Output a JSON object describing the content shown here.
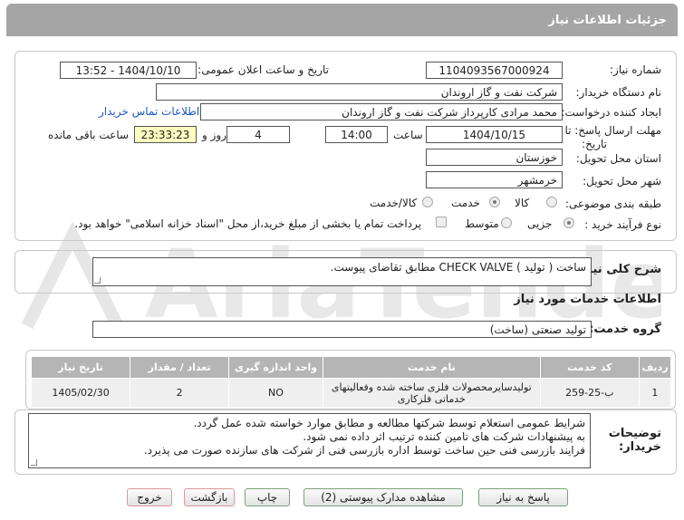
{
  "header": {
    "title": "جزئیات اطلاعات نیاز"
  },
  "form": {
    "need_number": {
      "label": "شماره نیاز:",
      "value": "1104093567000924"
    },
    "announce_datetime": {
      "label": "تاریخ و ساعت اعلان عمومی:",
      "value": "1404/10/10 - 13:52"
    },
    "buyer_org": {
      "label": "نام دستگاه خریدار:",
      "value": "شرکت نفت و گاز اروندان"
    },
    "requester": {
      "label": "ایجاد کننده درخواست:",
      "value": "محمد مرادی کارپرداز شرکت نفت و گاز اروندان",
      "contact_link": "اطلاعات تماس خریدار"
    },
    "deadline": {
      "label": "مهلت ارسال پاسخ: تا",
      "label2": "تاریخ:",
      "date": "1404/10/15",
      "time_label": "ساعت",
      "time": "14:00",
      "days": "4",
      "days_label": "روز و",
      "remaining": "23:33:23",
      "remaining_label": "ساعت باقی مانده"
    },
    "province": {
      "label": "استان محل تحویل:",
      "value": "خوزستان"
    },
    "city": {
      "label": "شهر محل تحویل:",
      "value": "خرمشهر"
    },
    "category": {
      "label": "طبقه بندی موضوعی:",
      "options": [
        "کالا",
        "خدمت",
        "کالا/خدمت"
      ],
      "selected": "خدمت"
    },
    "purchase_type": {
      "label": "نوع فرآیند خرید :",
      "options": [
        "جزیی",
        "متوسط"
      ],
      "checkbox_label": "پرداخت تمام یا بخشی از مبلغ خرید،از محل \"اسناد خزانه اسلامی\" خواهد بود."
    }
  },
  "description": {
    "label": "شرح کلی نیاز:",
    "value": "ساخت ( تولید ) CHECK VALVE مطابق تقاضای پیوست."
  },
  "services_section": {
    "title": "اطلاعات خدمات مورد نیاز"
  },
  "service_group": {
    "label": "گروه خدمت:",
    "value": "تولید صنعتی (ساخت)"
  },
  "table": {
    "headers": [
      "ردیف",
      "کد خدمت",
      "نام خدمت",
      "واحد اندازه گیری",
      "تعداد / مقدار",
      "تاریخ نیاز"
    ],
    "rows": [
      [
        "1",
        "ب-25-259",
        "تولیدسایرمحصولات فلزی ساخته شده وفعالیتهای خدماتی فلزکاری",
        "NO",
        "2",
        "1405/02/30"
      ]
    ]
  },
  "buyer_notes": {
    "label": "توضیحات خریدار:",
    "lines": [
      "شرایط عمومی استعلام توسط شرکتها مطالعه و مطابق موارد خواسته شده عمل گردد.",
      "به پیشنهادات شرکت های تامین کننده ترتیب اثر داده نمی شود.",
      "فرایند بازرسی فنی حین ساخت توسط اداره بازرسی فنی از شرکت های سازنده صورت می پذیرد."
    ]
  },
  "buttons": {
    "reply": "پاسخ به نیاز",
    "view_docs": "مشاهده مدارک پیوستی (2)",
    "print": "چاپ",
    "back": "بازگشت",
    "exit": "خروج"
  },
  "colors": {
    "header_bg": "#a5a5a5",
    "link": "#1a56c8",
    "timer_bg": "#ffffc0",
    "watermark": "#e3e3e3"
  },
  "watermark_logo_text": "AriaTender.net"
}
